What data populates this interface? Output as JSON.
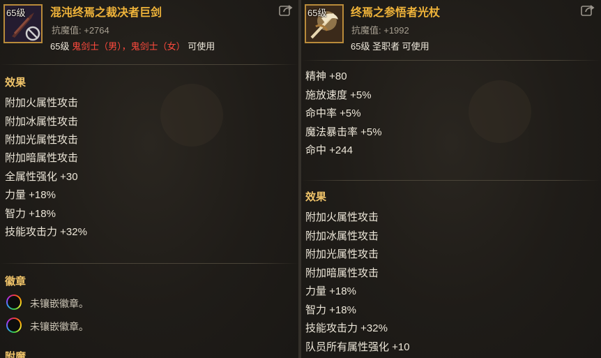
{
  "left_item": {
    "level_badge": "65级",
    "name": "混沌终焉之裁决者巨剑",
    "resist": "抗魔值: +2764",
    "usable_level": "65级",
    "usable_classes": "鬼剑士（男），鬼剑士（女）",
    "usable_suffix": "可使用",
    "effects_header": "效果",
    "effects": [
      "附加火属性攻击",
      "附加冰属性攻击",
      "附加光属性攻击",
      "附加暗属性攻击",
      "全属性强化 +30",
      "力量 +18%",
      "智力 +18%",
      "技能攻击力 +32%"
    ],
    "emblem_header": "徽章",
    "emblems": [
      "未镶嵌徽章。",
      "未镶嵌徽章。"
    ],
    "enchant_header": "附魔"
  },
  "right_item": {
    "level_badge": "65级",
    "name": "终焉之参悟者光杖",
    "resist": "抗魔值: +1992",
    "usable": "65级 圣职者 可使用",
    "stats": [
      "精神 +80",
      "施放速度 +5%",
      "命中率 +5%",
      "魔法暴击率 +5%",
      "命中 +244"
    ],
    "effects_header": "效果",
    "effects": [
      "附加火属性攻击",
      "附加冰属性攻击",
      "附加光属性攻击",
      "附加暗属性攻击",
      "力量 +18%",
      "智力 +18%",
      "技能攻击力 +32%",
      "队员所有属性强化 +10"
    ]
  },
  "icons": {
    "share": "share-icon",
    "forbidden": "forbidden-icon",
    "emblem_slot": "emblem-slot-icon"
  },
  "colors": {
    "title": "#f0b43a",
    "section": "#f0c46a",
    "restricted_class": "#ff4a3d",
    "icon_border": "#b98b3a"
  }
}
